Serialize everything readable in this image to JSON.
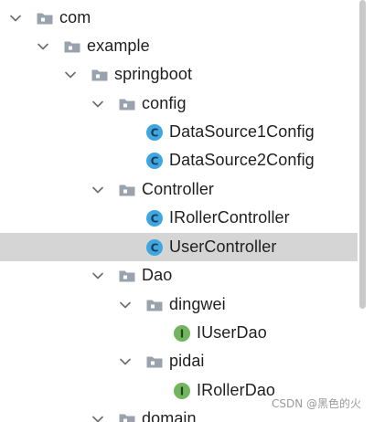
{
  "tree": {
    "nodes": [
      {
        "label": "com",
        "type": "folder",
        "expanded": true,
        "selected": false
      },
      {
        "label": "example",
        "type": "folder",
        "expanded": true,
        "selected": false
      },
      {
        "label": "springboot",
        "type": "folder",
        "expanded": true,
        "selected": false
      },
      {
        "label": "config",
        "type": "folder",
        "expanded": true,
        "selected": false
      },
      {
        "label": "DataSource1Config",
        "type": "class",
        "icon_letter": "C",
        "selected": false
      },
      {
        "label": "DataSource2Config",
        "type": "class",
        "icon_letter": "C",
        "selected": false
      },
      {
        "label": "Controller",
        "type": "folder",
        "expanded": true,
        "selected": false
      },
      {
        "label": "IRollerController",
        "type": "class",
        "icon_letter": "C",
        "selected": false
      },
      {
        "label": "UserController",
        "type": "class",
        "icon_letter": "C",
        "selected": true
      },
      {
        "label": "Dao",
        "type": "folder",
        "expanded": true,
        "selected": false
      },
      {
        "label": "dingwei",
        "type": "folder",
        "expanded": true,
        "selected": false
      },
      {
        "label": "IUserDao",
        "type": "interface",
        "icon_letter": "I",
        "selected": false
      },
      {
        "label": "pidai",
        "type": "folder",
        "expanded": true,
        "selected": false
      },
      {
        "label": "IRollerDao",
        "type": "interface",
        "icon_letter": "I",
        "selected": false
      },
      {
        "label": "domain",
        "type": "folder",
        "expanded": true,
        "selected": false
      }
    ]
  },
  "watermark": "CSDN @黑色的火",
  "colors": {
    "selection": "#d5d5d5",
    "class_icon": "#3fa7e0",
    "interface_icon": "#72b55f",
    "folder_icon": "#9aa3ad",
    "chevron": "#6e6e6e"
  },
  "icons": {
    "expand": "chevron-down-icon",
    "folder": "folder-icon",
    "class": "class-icon",
    "interface": "interface-icon"
  }
}
